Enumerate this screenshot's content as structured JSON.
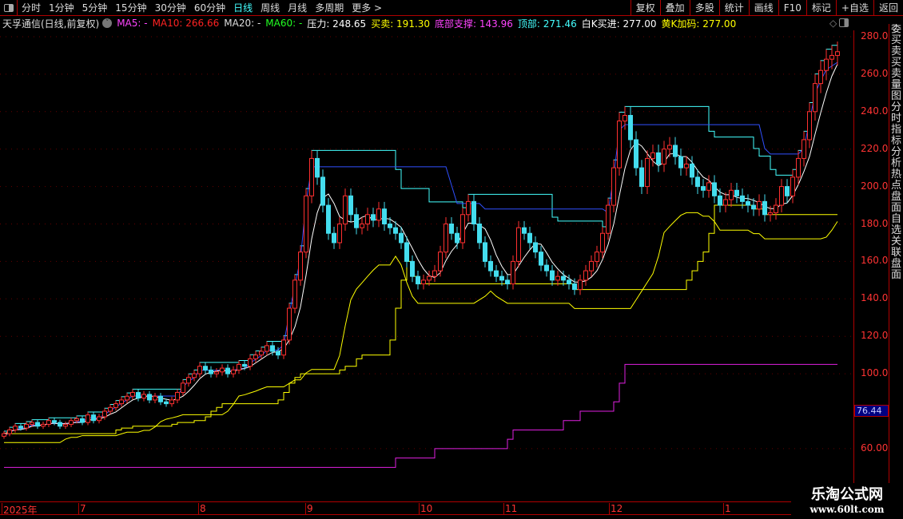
{
  "toolbar": {
    "periods": [
      "分时",
      "1分钟",
      "5分钟",
      "15分钟",
      "30分钟",
      "60分钟",
      "日线",
      "周线",
      "月线",
      "多周期",
      "更多 >"
    ],
    "active": "日线",
    "buttons": [
      "复权",
      "叠加",
      "多股",
      "统计",
      "画线",
      "F10",
      "标记",
      "+自选",
      "返回"
    ]
  },
  "info": {
    "title": "天孚通信(日线,前复权)",
    "ma5": "MA5: -",
    "ma10": "MA10: 266.66",
    "ma20": "MA20: -",
    "ma60": "MA60: -",
    "pressure": "压力: 248.65",
    "trade": "买卖: 191.30",
    "support": "底部支撑: 143.96",
    "top": "顶部: 271.46",
    "whitek": "白K买进: 277.00",
    "yellowk": "黄K加码: 277.00"
  },
  "colors": {
    "ma5": "#ff44ff",
    "ma10": "#ff2222",
    "ma20": "#dddddd",
    "ma60": "#22ff22",
    "pressure": "#ffffff",
    "trade": "#ffff00",
    "support": "#ff44ff",
    "top": "#44ffff",
    "up": "#ff3030",
    "down": "#44ddee"
  },
  "axis": {
    "ticks": [
      "280.0",
      "260.0",
      "240.0",
      "220.0",
      "200.0",
      "180.0",
      "160.0",
      "140.0",
      "120.0",
      "100.0",
      "60.00"
    ],
    "current": "76.44"
  },
  "side_strip": "委买卖买卖量图分时指标分析热点盘面自选关联盘面",
  "dates": [
    "2025年",
    "7",
    "8",
    "9",
    "10",
    "11",
    "12",
    "1"
  ],
  "watermark": {
    "name": "乐淘公式网",
    "url": "www.60lt.com"
  },
  "chart_data": {
    "type": "candlestick",
    "y_range": [
      55,
      285
    ],
    "closes": [
      68,
      70,
      72,
      71,
      73,
      74,
      72,
      73,
      75,
      74,
      72,
      73,
      75,
      76,
      74,
      78,
      75,
      77,
      80,
      82,
      84,
      86,
      88,
      90,
      87,
      89,
      86,
      88,
      85,
      84,
      86,
      90,
      95,
      98,
      100,
      104,
      102,
      100,
      101,
      103,
      100,
      102,
      105,
      104,
      108,
      110,
      112,
      115,
      112,
      110,
      118,
      135,
      150,
      165,
      195,
      215,
      205,
      190,
      175,
      170,
      180,
      195,
      185,
      178,
      180,
      185,
      182,
      188,
      180,
      178,
      175,
      170,
      160,
      152,
      148,
      150,
      152,
      155,
      165,
      180,
      175,
      170,
      185,
      192,
      180,
      170,
      160,
      155,
      152,
      150,
      148,
      160,
      178,
      175,
      170,
      165,
      158,
      155,
      150,
      152,
      150,
      148,
      145,
      150,
      155,
      160,
      165,
      175,
      190,
      210,
      235,
      238,
      225,
      210,
      200,
      215,
      218,
      212,
      220,
      222,
      216,
      210,
      212,
      205,
      200,
      198,
      202,
      195,
      190,
      193,
      198,
      195,
      192,
      190,
      188,
      192,
      185,
      186,
      190,
      200,
      195,
      205,
      215,
      225,
      240,
      255,
      262,
      268,
      270,
      272
    ]
  }
}
